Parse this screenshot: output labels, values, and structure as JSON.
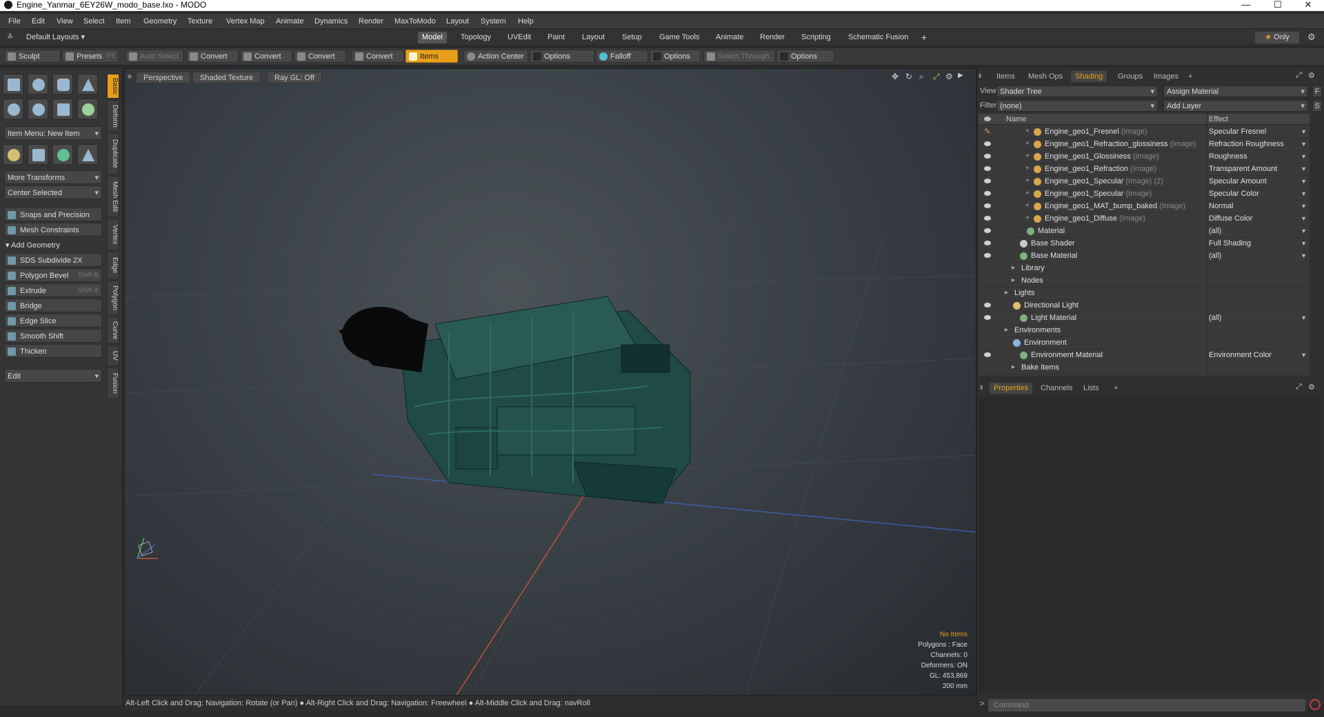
{
  "window": {
    "title": "Engine_Yanmar_6EY26W_modo_base.lxo - MODO",
    "controls": [
      "—",
      "☐",
      "✕"
    ]
  },
  "menu": [
    "File",
    "Edit",
    "View",
    "Select",
    "Item",
    "Geometry",
    "Texture",
    "Vertex Map",
    "Animate",
    "Dynamics",
    "Render",
    "MaxToModo",
    "Layout",
    "System",
    "Help"
  ],
  "layouts": {
    "label": "Default Layouts",
    "tabs": [
      "Model",
      "Topology",
      "UVEdit",
      "Paint",
      "Layout",
      "Setup",
      "Game Tools",
      "Animate",
      "Render",
      "Scripting",
      "Schematic Fusion"
    ],
    "active_tab": "Model",
    "plus": "+",
    "only": "Only"
  },
  "toolbar": {
    "sculpt": "Sculpt",
    "presets": "Presets",
    "presets_key": "F6",
    "auto_select": "Auto Select",
    "convert": "Convert",
    "items": "Items",
    "action_center": "Action Center",
    "options": "Options",
    "falloff": "Falloff",
    "select_through": "Select Through"
  },
  "left": {
    "item_menu": "Item Menu: New Item",
    "more_transforms": "More Transforms",
    "center_selected": "Center Selected",
    "snaps": "Snaps and Precision",
    "mesh_constraints": "Mesh Constraints",
    "add_geometry": "Add Geometry",
    "tools": [
      {
        "label": "SDS Subdivide 2X",
        "key": ""
      },
      {
        "label": "Polygon Bevel",
        "key": "Shift-B"
      },
      {
        "label": "Extrude",
        "key": "Shift-X"
      },
      {
        "label": "Bridge",
        "key": ""
      },
      {
        "label": "Edge Slice",
        "key": ""
      },
      {
        "label": "Smooth Shift",
        "key": ""
      },
      {
        "label": "Thicken",
        "key": ""
      }
    ],
    "edit": "Edit",
    "vtabs": [
      "Basic",
      "Deform",
      "Duplicate",
      "Mesh Edit",
      "Vertex",
      "Edge",
      "Polygon",
      "Curve",
      "UV",
      "Fusion"
    ]
  },
  "viewport": {
    "perspective": "Perspective",
    "shaded": "Shaded Texture",
    "raygl": "Ray GL: Off",
    "info": {
      "no_items": "No Items",
      "polygons": "Polygons : Face",
      "channels": "Channels: 0",
      "deformers": "Deformers: ON",
      "gl": "GL: 453,869",
      "size": "200 mm"
    }
  },
  "status": "Alt-Left Click and Drag: Navigation: Rotate (or Pan) ● Alt-Right Click and Drag: Navigation: Freewheel ● Alt-Middle Click and Drag: navRoll",
  "right": {
    "tabs": [
      "Items",
      "Mesh Ops",
      "Shading",
      "Groups",
      "Images"
    ],
    "active_tab": "Shading",
    "view_label": "View",
    "view_value": "Shader Tree",
    "assign": "Assign Material",
    "filter_label": "Filter",
    "filter_value": "(none)",
    "add_layer": "Add Layer",
    "col_name": "Name",
    "col_effect": "Effect",
    "rows": [
      {
        "name": "Engine_geo1_Fresnel",
        "tag": "(Image)",
        "effect": "Specular Fresnel",
        "indent": 4,
        "icon": "#d6a84a",
        "eye": "brush"
      },
      {
        "name": "Engine_geo1_Refraction_glossiness",
        "tag": "(Image)",
        "effect": "Refraction Roughness",
        "indent": 4,
        "icon": "#d6a84a",
        "eye": "eye"
      },
      {
        "name": "Engine_geo1_Glossiness",
        "tag": "(Image)",
        "effect": "Roughness",
        "indent": 4,
        "icon": "#d6a84a",
        "eye": "eye"
      },
      {
        "name": "Engine_geo1_Refraction",
        "tag": "(Image)",
        "effect": "Transparent Amount",
        "indent": 4,
        "icon": "#d6a84a",
        "eye": "eye"
      },
      {
        "name": "Engine_geo1_Specular",
        "tag": "(Image) (2)",
        "effect": "Specular Amount",
        "indent": 4,
        "icon": "#d6a84a",
        "eye": "eye"
      },
      {
        "name": "Engine_geo1_Specular",
        "tag": "(Image)",
        "effect": "Specular Color",
        "indent": 4,
        "icon": "#d6a84a",
        "eye": "eye"
      },
      {
        "name": "Engine_geo1_MAT_bump_baked",
        "tag": "(Image)",
        "effect": "Normal",
        "indent": 4,
        "icon": "#d6a84a",
        "eye": "eye"
      },
      {
        "name": "Engine_geo1_Diffuse",
        "tag": "(Image)",
        "effect": "Diffuse Color",
        "indent": 4,
        "icon": "#d6a84a",
        "eye": "eye"
      },
      {
        "name": "Material",
        "tag": "",
        "effect": "(all)",
        "indent": 3,
        "icon": "#7fb07f",
        "eye": "eye"
      },
      {
        "name": "Base Shader",
        "tag": "",
        "effect": "Full Shading",
        "indent": 2,
        "icon": "#c8c8c8",
        "eye": "eye"
      },
      {
        "name": "Base Material",
        "tag": "",
        "effect": "(all)",
        "indent": 2,
        "icon": "#7fb07f",
        "eye": "eye"
      },
      {
        "name": "Library",
        "tag": "",
        "effect": "",
        "indent": 1,
        "icon": "",
        "eye": ""
      },
      {
        "name": "Nodes",
        "tag": "",
        "effect": "",
        "indent": 1,
        "icon": "",
        "eye": ""
      },
      {
        "name": "Lights",
        "tag": "",
        "effect": "",
        "indent": 0,
        "icon": "",
        "eye": ""
      },
      {
        "name": "Directional Light",
        "tag": "",
        "effect": "",
        "indent": 1,
        "icon": "#e0c070",
        "eye": "eye"
      },
      {
        "name": "Light Material",
        "tag": "",
        "effect": "(all)",
        "indent": 2,
        "icon": "#7fb07f",
        "eye": "eye"
      },
      {
        "name": "Environments",
        "tag": "",
        "effect": "",
        "indent": 0,
        "icon": "",
        "eye": ""
      },
      {
        "name": "Environment",
        "tag": "",
        "effect": "",
        "indent": 1,
        "icon": "#8fb0e0",
        "eye": ""
      },
      {
        "name": "Environment Material",
        "tag": "",
        "effect": "Environment Color",
        "indent": 2,
        "icon": "#7fb07f",
        "eye": "eye"
      },
      {
        "name": "Bake Items",
        "tag": "",
        "effect": "",
        "indent": 1,
        "icon": "",
        "eye": ""
      }
    ],
    "props_tabs": [
      "Properties",
      "Channels",
      "Lists"
    ],
    "command": "Command"
  }
}
